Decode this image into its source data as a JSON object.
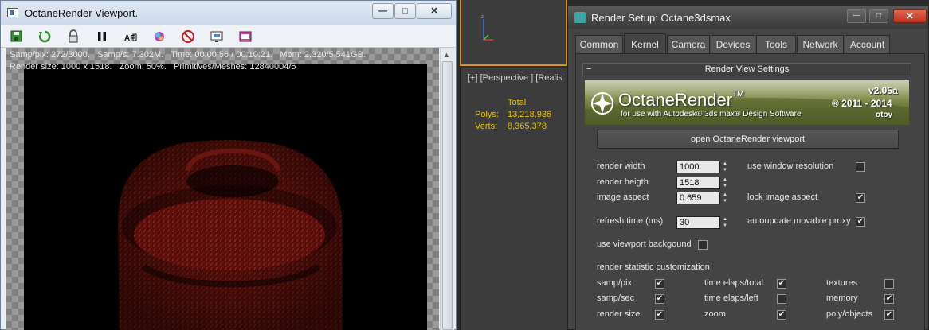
{
  "viewport": {
    "title": "OctaneRender Viewport.",
    "window_buttons": {
      "minimize": "—",
      "maximize": "□",
      "close": "✕"
    },
    "toolbar_icons": [
      "save-render-icon",
      "restart-render-icon",
      "lock-icon",
      "pause-icon",
      "af-focus-icon",
      "color-picker-icon",
      "clay-mode-icon",
      "region-icon",
      "film-settings-icon"
    ],
    "stats_line1": "Samp/pix: 272/3000.   Samp/s: 7.302M.   Time: 00:00:56 / 00:10:21.   Mem: 2.320/5.541GB.",
    "stats_line2": "Render size: 1000 x 1518.   Zoom: 50%.   Primitives/Meshes: 12840004/5"
  },
  "max": {
    "viewport_label": "[+] [Perspective ] [Realis",
    "stats_header": "Total",
    "polys_label": "Polys:",
    "polys_value": "13,218,936",
    "verts_label": "Verts:",
    "verts_value": "8,365,378"
  },
  "render_setup": {
    "title": "Render Setup: Octane3dsmax",
    "tabs": [
      "Common",
      "Kernel",
      "Camera",
      "Devices",
      "Tools",
      "Network",
      "Account"
    ],
    "active_tab": "Kernel",
    "section_title": "Render View Settings",
    "banner": {
      "brand": "OctaneRender",
      "tm": "TM",
      "subtitle": "for use with Autodesk® 3ds max® Design Software",
      "version": "v2.05a",
      "years": "® 2011 - 2014",
      "company": "otoy"
    },
    "open_button": "open OctaneRender viewport",
    "render_width_label": "render width",
    "render_width_value": "1000",
    "render_height_label": "render heigth",
    "render_height_value": "1518",
    "image_aspect_label": "image aspect",
    "image_aspect_value": "0.659",
    "refresh_label": "refresh time (ms)",
    "refresh_value": "30",
    "use_window_res_label": "use window resolution",
    "use_window_res": false,
    "lock_aspect_label": "lock image aspect",
    "lock_aspect": true,
    "autoupdate_label": "autoupdate movable proxy",
    "autoupdate": true,
    "use_vp_bg_label": "use viewport backgound",
    "use_vp_bg": false,
    "stat_custom_label": "render statistic customization",
    "stats_opts": [
      {
        "label": "samp/pix",
        "checked": true
      },
      {
        "label": "time elaps/total",
        "checked": true
      },
      {
        "label": "textures",
        "checked": false
      },
      {
        "label": "samp/sec",
        "checked": true
      },
      {
        "label": "time elaps/left",
        "checked": false
      },
      {
        "label": "memory",
        "checked": true
      },
      {
        "label": "render size",
        "checked": true
      },
      {
        "label": "zoom",
        "checked": true
      },
      {
        "label": "poly/objects",
        "checked": true
      }
    ]
  },
  "colors": {
    "stats_yellow": "#e8c000",
    "viewport_border": "#d59a15",
    "render_red": "#8a1a12"
  }
}
